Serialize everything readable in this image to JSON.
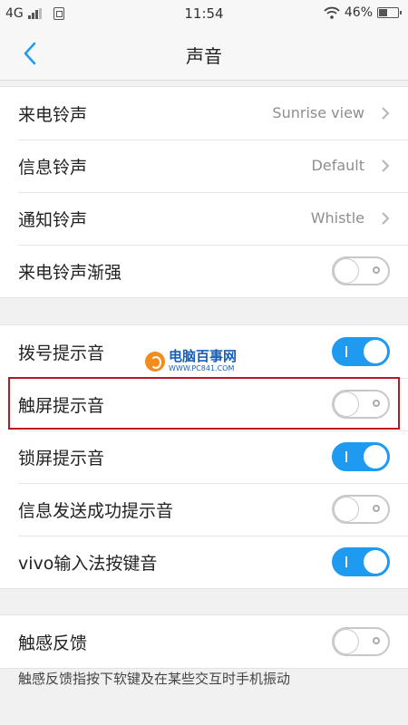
{
  "status_bar": {
    "network": "4G",
    "time": "11:54",
    "battery_percent": "46%",
    "battery_level": 0.46
  },
  "navbar": {
    "title": "声音"
  },
  "ringtones": [
    {
      "label": "来电铃声",
      "value": "Sunrise view"
    },
    {
      "label": "信息铃声",
      "value": "Default"
    },
    {
      "label": "通知铃声",
      "value": "Whistle"
    }
  ],
  "ring_fade": {
    "label": "来电铃声渐强",
    "enabled": false
  },
  "sound_toggles": [
    {
      "label": "拨号提示音",
      "enabled": true
    },
    {
      "label": "触屏提示音",
      "enabled": false
    },
    {
      "label": "锁屏提示音",
      "enabled": true
    },
    {
      "label": "信息发送成功提示音",
      "enabled": false
    },
    {
      "label": "vivo输入法按键音",
      "enabled": true
    }
  ],
  "haptic": {
    "label": "触感反馈",
    "enabled": false
  },
  "footnote": "触感反馈指按下软键及在某些交互时手机振动",
  "watermark": {
    "title": "电脑百事网",
    "url": "WWW.PC841.COM"
  },
  "colors": {
    "accent": "#1e9bf0",
    "highlight": "#c0161d"
  }
}
